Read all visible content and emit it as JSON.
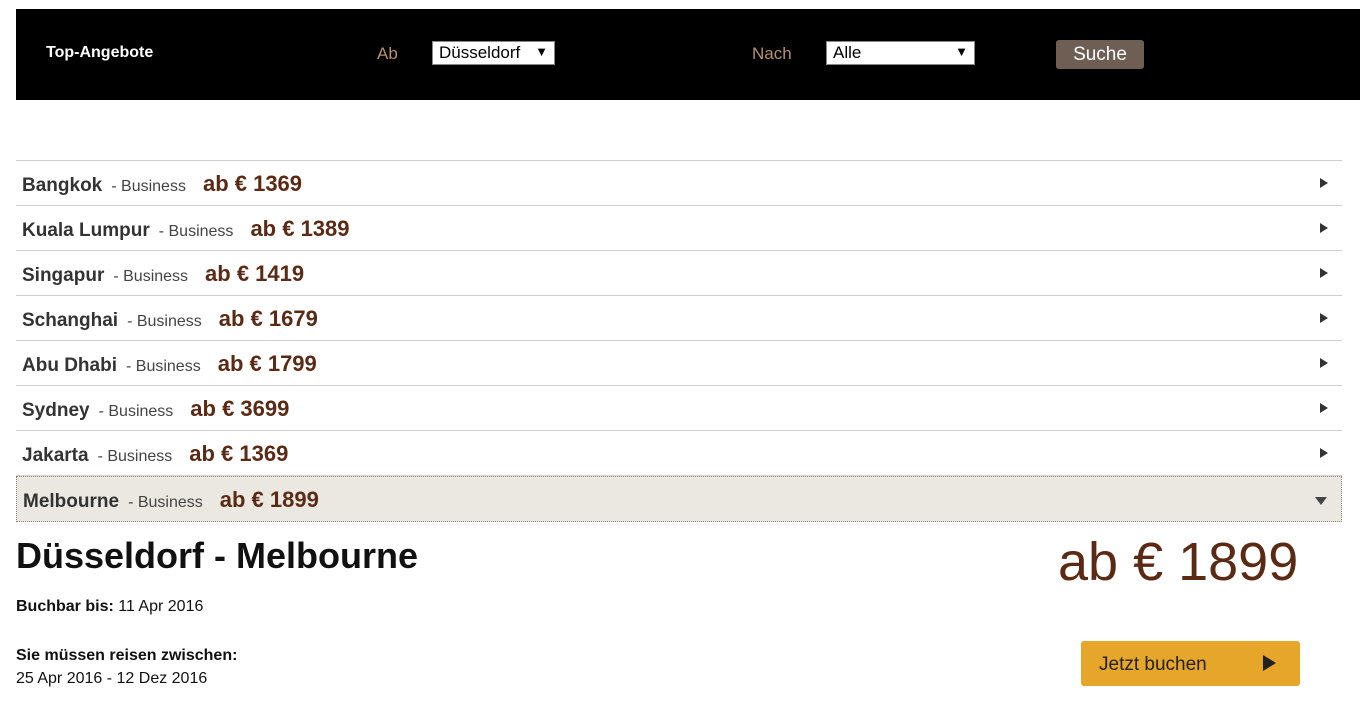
{
  "header": {
    "title": "Top-Angebote",
    "from_label": "Ab",
    "from_value": "Düsseldorf",
    "to_label": "Nach",
    "to_value": "Alle",
    "search_label": "Suche"
  },
  "offers": [
    {
      "city": "Bangkok",
      "class": "- Business",
      "price": "ab € 1369"
    },
    {
      "city": "Kuala Lumpur",
      "class": "- Business",
      "price": "ab € 1389"
    },
    {
      "city": "Singapur",
      "class": "- Business",
      "price": "ab € 1419"
    },
    {
      "city": "Schanghai",
      "class": "- Business",
      "price": "ab € 1679"
    },
    {
      "city": "Abu Dhabi",
      "class": "- Business",
      "price": "ab € 1799"
    },
    {
      "city": "Sydney",
      "class": "- Business",
      "price": "ab € 3699"
    },
    {
      "city": "Jakarta",
      "class": "- Business",
      "price": "ab € 1369"
    },
    {
      "city": "Melbourne",
      "class": "- Business",
      "price": "ab € 1899"
    }
  ],
  "detail": {
    "route": "Düsseldorf - Melbourne",
    "price": "ab € 1899",
    "bookable_label": "Buchbar bis:",
    "bookable_date": "11 Apr 2016",
    "travel_label": "Sie müssen reisen zwischen:",
    "travel_dates": "25 Apr 2016 - 12 Dez 2016",
    "book_label": "Jetzt buchen"
  },
  "colors": {
    "header_bg": "#000000",
    "label_accent": "#b8906a",
    "price": "#5a2a14",
    "book_button": "#e6a629",
    "search_button": "#6e5e54",
    "active_row_bg": "#ebe7e1"
  }
}
